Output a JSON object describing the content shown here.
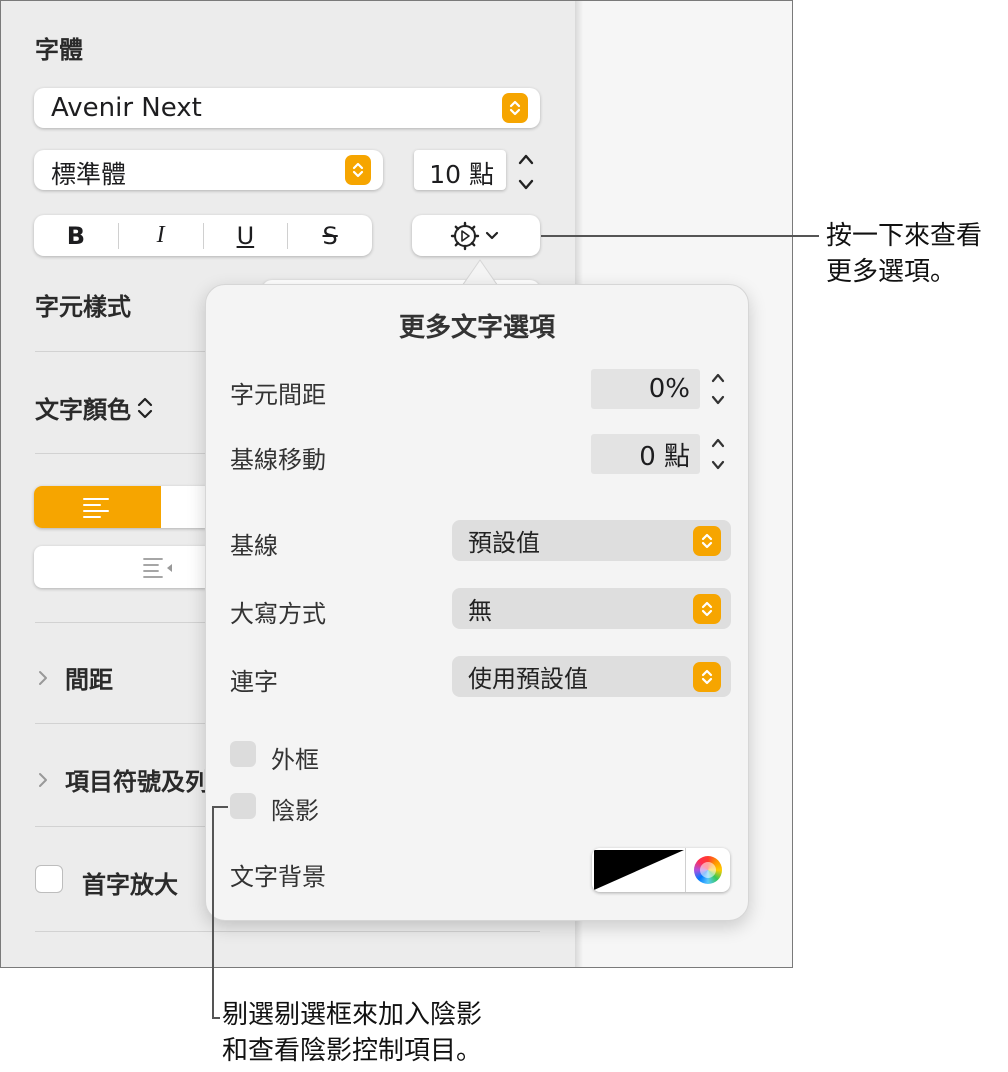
{
  "sidebar": {
    "font_heading": "字體",
    "font_family": "Avenir Next",
    "font_style": "標準體",
    "font_size": "10 點",
    "format_buttons": {
      "bold": "B",
      "italic": "I",
      "underline": "U",
      "strikethrough": "S"
    },
    "character_styles_label": "字元樣式",
    "text_color_label": "文字顏色",
    "spacing_label": "間距",
    "bullets_label": "項目符號及列",
    "drop_cap_label": "首字放大"
  },
  "panel": {
    "title": "更多文字選項",
    "char_spacing_label": "字元間距",
    "char_spacing_value": "0%",
    "baseline_shift_label": "基線移動",
    "baseline_shift_value": "0 點",
    "baseline_label": "基線",
    "baseline_value": "預設值",
    "capitalization_label": "大寫方式",
    "capitalization_value": "無",
    "ligatures_label": "連字",
    "ligatures_value": "使用預設值",
    "outline_label": "外框",
    "shadow_label": "陰影",
    "text_background_label": "文字背景"
  },
  "callouts": {
    "gear": [
      "按一下來查看",
      "更多選項。"
    ],
    "shadow": [
      "剔選剔選框來加入陰影",
      "和查看陰影控制項目。"
    ]
  },
  "colors": {
    "accent": "#f6a500",
    "panel_bg": "#f4f4f4",
    "sidebar_bg": "#ececec"
  }
}
